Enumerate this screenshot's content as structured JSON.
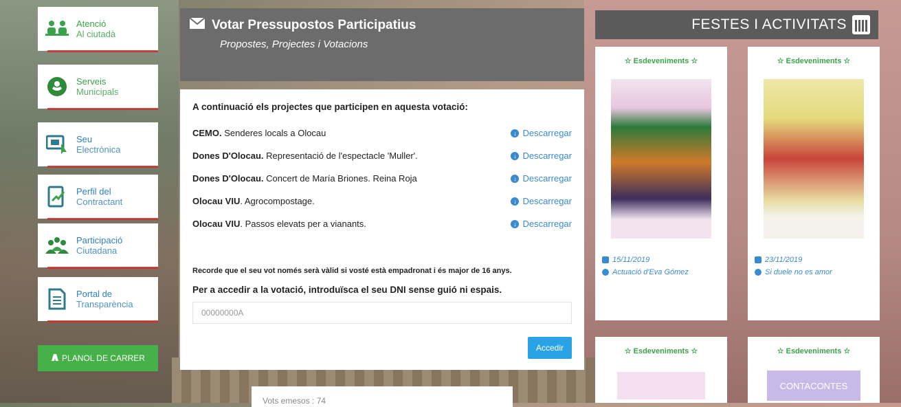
{
  "sidebar": {
    "items": [
      {
        "line1": "Atenció",
        "line2": "Al ciutadà",
        "icon": "people-desk-icon"
      },
      {
        "line1": "Serveis",
        "line2": "Municipals",
        "icon": "hand-heart-icon"
      },
      {
        "line1": "Seu",
        "line2": "Electrònica",
        "icon": "monitor-click-icon"
      },
      {
        "line1": "Perfil del",
        "line2": "Contractant",
        "icon": "document-edit-icon"
      },
      {
        "line1": "Participació",
        "line2": "Ciutadana",
        "icon": "group-icon"
      },
      {
        "line1": "Portal de",
        "line2": "Transparència",
        "icon": "file-list-icon"
      }
    ],
    "planol_label": "PLANOL DE CARRER"
  },
  "main": {
    "title": "Votar Pressupostos Participatius",
    "subtitle": "Propostes, Projectes i Votacions",
    "intro": "A continuació els projectes que participen en aquesta votació:",
    "projects": [
      {
        "org": "CEMO.",
        "desc": "Senderes locals a Olocau",
        "download": "Descarregar"
      },
      {
        "org": "Dones D'Olocau.",
        "desc": "Representació de l'espectacle 'Muller'.",
        "download": "Descarregar"
      },
      {
        "org": "Dones D'Olocau.",
        "desc": "Concert de María Briones. Reina Roja",
        "download": "Descarregar"
      },
      {
        "org": "Olocau VIU",
        "desc": ". Agrocompostage.",
        "download": "Descarregar"
      },
      {
        "org": "Olocau VIU",
        "desc": ". Passos elevats per a vianants.",
        "download": "Descarregar"
      }
    ],
    "notice": "Recorde que el seu vot només serà vàlid si vosté està empadronat i és major de 16 anys.",
    "instruction": "Per a accedir a la votació, introduïsca el seu DNI sense guió ni espais.",
    "dni_placeholder": "00000000A",
    "submit_label": "Accedir",
    "votes_text": "Vots emesos : 74"
  },
  "events": {
    "header": "FESTES I ACTIVITATS",
    "cards": [
      {
        "tag": "☆ Esdeveniments ☆",
        "date": "15/11/2019",
        "title": "Actuació d'Eva Gómez"
      },
      {
        "tag": "☆ Esdeveniments ☆",
        "date": "23/11/2019",
        "title": "Si duele no es amor"
      },
      {
        "tag": "☆ Esdeveniments ☆"
      },
      {
        "tag": "☆ Esdeveniments ☆",
        "button": "CONTACONTES"
      }
    ]
  },
  "colors": {
    "green": "#3aa24a",
    "blue": "#3a8ad1",
    "red": "#c9302c",
    "dark_header": "#6c6c6c"
  }
}
